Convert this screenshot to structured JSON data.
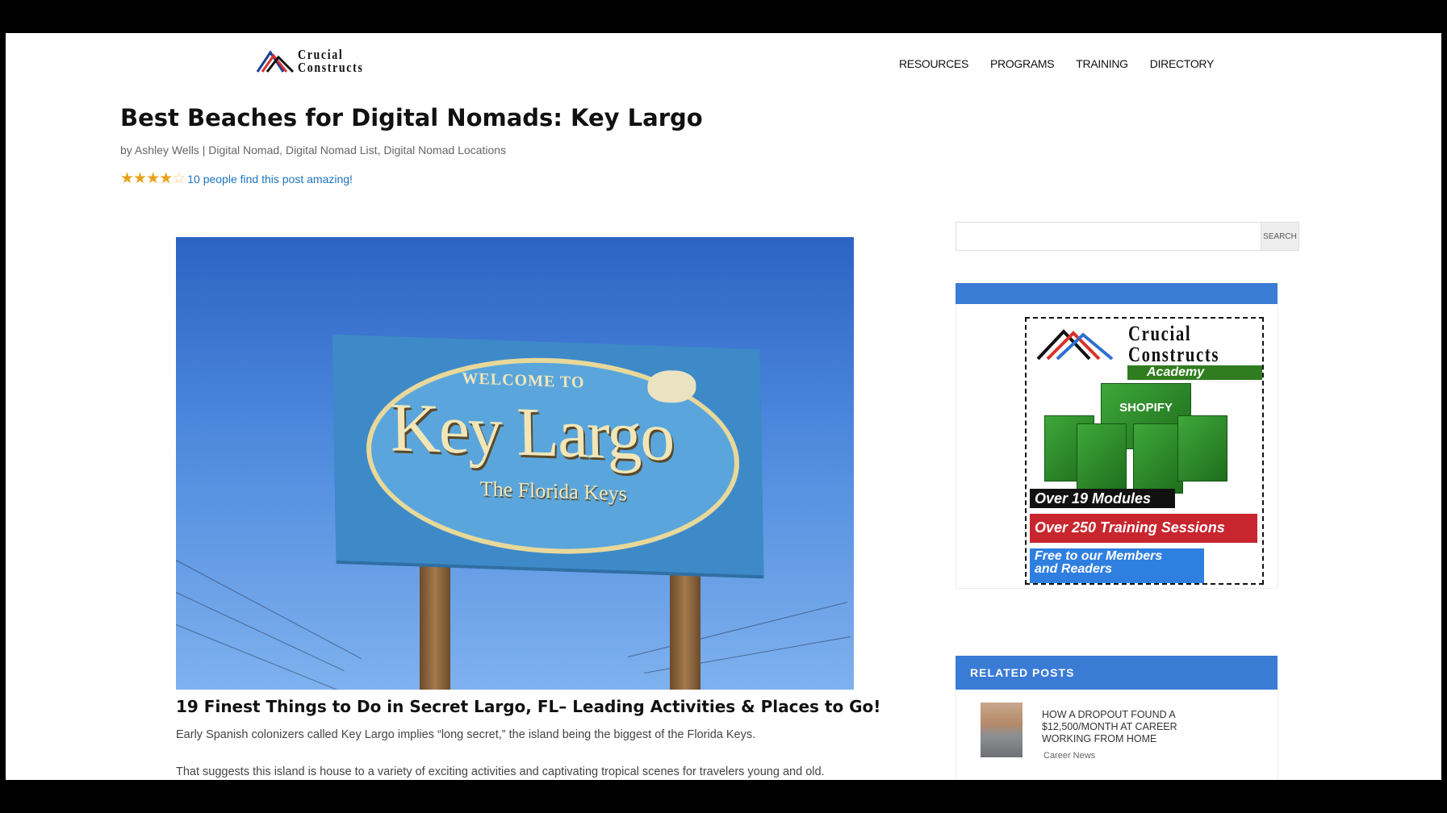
{
  "header": {
    "logo_line1": "Crucial",
    "logo_line2": "Constructs",
    "nav": [
      "RESOURCES",
      "PROGRAMS",
      "TRAINING",
      "DIRECTORY"
    ]
  },
  "post": {
    "title": "Best Beaches for Digital Nomads: Key Largo",
    "meta_by": "by",
    "author": "Ashley Wells",
    "meta_sep": "|",
    "categories": [
      "Digital Nomad",
      "Digital Nomad List",
      "Digital Nomad Locations"
    ],
    "rating": {
      "value": 4.5,
      "max": 5,
      "text": "10 people find this post amazing!"
    },
    "hero_sign": {
      "welcome": "WELCOME TO",
      "title": "Key Largo",
      "subtitle": "The Florida Keys"
    },
    "heading": "19 Finest Things to Do in Secret Largo, FL– Leading Activities & Places to Go!",
    "paragraphs": [
      "Early Spanish colonizers called Key Largo implies “long secret,” the island being the biggest of the Florida Keys.",
      "That suggests this island is house to a variety of exciting activities and captivating tropical scenes for travelers young and old."
    ]
  },
  "sidebar": {
    "search": {
      "placeholder": "",
      "button": "SEARCH"
    },
    "promo": {
      "brand_line1": "Crucial",
      "brand_line2": "Constructs",
      "academy": "Academy",
      "box_label": "SHOPIFY",
      "label1": "Over 19 Modules",
      "label2": "Over 250 Training Sessions",
      "label3_line1": "Free to our Members",
      "label3_line2": "and Readers"
    },
    "related": {
      "heading": "RELATED POSTS",
      "items": [
        {
          "title": "HOW A DROPOUT FOUND A $12,500/MONTH AT CAREER WORKING FROM HOME",
          "category": "Career News"
        }
      ]
    }
  },
  "colors": {
    "accent": "#3a7bd5",
    "link": "#1e73be",
    "star": "#e8a21a"
  }
}
